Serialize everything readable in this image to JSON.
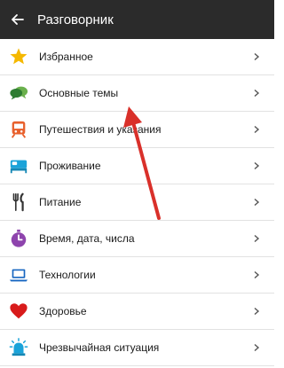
{
  "app_bar": {
    "title": "Разговорник",
    "back_icon": "arrow-left-icon",
    "background": "#2b2b2b"
  },
  "categories": [
    {
      "label": "Избранное",
      "icon": "star-icon",
      "color": "#f5b800"
    },
    {
      "label": "Основные темы",
      "icon": "speech-bubbles-icon",
      "color": "#6ab04c"
    },
    {
      "label": "Путешествия и указания",
      "icon": "train-icon",
      "color": "#e8602c"
    },
    {
      "label": "Проживание",
      "icon": "bed-icon",
      "color": "#1aa3d9"
    },
    {
      "label": "Питание",
      "icon": "fork-knife-icon",
      "color": "#333333"
    },
    {
      "label": "Время, дата, числа",
      "icon": "timer-icon",
      "color": "#8e44ad"
    },
    {
      "label": "Технологии",
      "icon": "laptop-icon",
      "color": "#1565c0"
    },
    {
      "label": "Здоровье",
      "icon": "heart-icon",
      "color": "#d81b1b"
    },
    {
      "label": "Чрезвычайная ситуация",
      "icon": "siren-icon",
      "color": "#1aa3d9"
    }
  ],
  "chevron_icon": "chevron-right-icon",
  "annotation_color": "#d9302a"
}
